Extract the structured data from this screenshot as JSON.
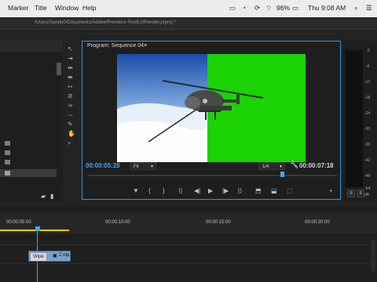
{
  "menubar": {
    "items": [
      "Marker",
      "Title",
      "Window",
      "Help"
    ],
    "battery": "96%",
    "clock": "Thu 9:08 AM"
  },
  "project_path": "/Users/Sandu0/Documents/Adobe/Premiere Pro/8.0/Render.prproj *",
  "program_monitor": {
    "title": "Program: Sequence 04",
    "menu_icon": "≡",
    "current_timecode": "00:00:05:28",
    "zoom": "Fit",
    "resolution": "1/4",
    "duration_timecode": "00:00:07:18"
  },
  "transport": {
    "icons": [
      "marker-icon",
      "in-icon",
      "out-icon",
      "goto-in-icon",
      "step-back-icon",
      "play-icon",
      "step-forward-icon",
      "goto-out-icon",
      "lift-icon",
      "extract-icon",
      "export-frame-icon",
      "add-icon"
    ]
  },
  "timeline": {
    "ruler_labels": [
      "00:00:05:00",
      "00:00:10:00",
      "00:00:15:00",
      "00:00:20:00"
    ],
    "clip_label": "Wipe",
    "clip_name": "2.mp"
  },
  "meter": {
    "scale": [
      "0",
      "-6",
      "-12",
      "-18",
      "-24",
      "-30",
      "-36",
      "-42",
      "-48",
      "-54",
      "dB"
    ],
    "bottom_labels": [
      "S",
      "S"
    ]
  },
  "colors": {
    "accent": "#3b8fd8",
    "green_screen": "#1bd300"
  }
}
